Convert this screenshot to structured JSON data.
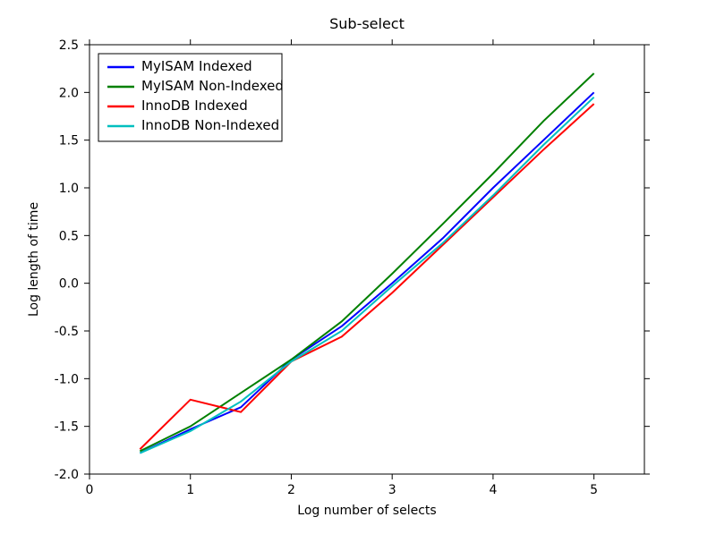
{
  "chart_data": {
    "type": "line",
    "title": "Sub-select",
    "xlabel": "Log number of selects",
    "ylabel": "Log length of time",
    "xlim": [
      0,
      5.5
    ],
    "ylim": [
      -2.0,
      2.5
    ],
    "xticks": [
      0,
      1,
      2,
      3,
      4,
      5
    ],
    "yticks": [
      -2.0,
      -1.5,
      -1.0,
      -0.5,
      0.0,
      0.5,
      1.0,
      1.5,
      2.0,
      2.5
    ],
    "x": [
      0.5,
      1.0,
      1.5,
      2.0,
      2.5,
      3.0,
      3.5,
      4.0,
      4.5,
      5.0
    ],
    "series": [
      {
        "name": "MyISAM Indexed",
        "color": "#0000ff",
        "values": [
          -1.78,
          -1.53,
          -1.3,
          -0.8,
          -0.45,
          0.0,
          0.47,
          1.0,
          1.5,
          2.0
        ]
      },
      {
        "name": "MyISAM Non-Indexed",
        "color": "#008000",
        "values": [
          -1.76,
          -1.5,
          -1.15,
          -0.8,
          -0.4,
          0.1,
          0.62,
          1.15,
          1.7,
          2.2
        ]
      },
      {
        "name": "InnoDB Indexed",
        "color": "#ff0000",
        "values": [
          -1.74,
          -1.22,
          -1.35,
          -0.82,
          -0.56,
          -0.1,
          0.4,
          0.9,
          1.4,
          1.88
        ]
      },
      {
        "name": "InnoDB Non-Indexed",
        "color": "#00bfbf",
        "values": [
          -1.78,
          -1.55,
          -1.24,
          -0.82,
          -0.5,
          -0.03,
          0.42,
          0.92,
          1.45,
          1.95
        ]
      }
    ],
    "legend_position": "upper-left"
  }
}
